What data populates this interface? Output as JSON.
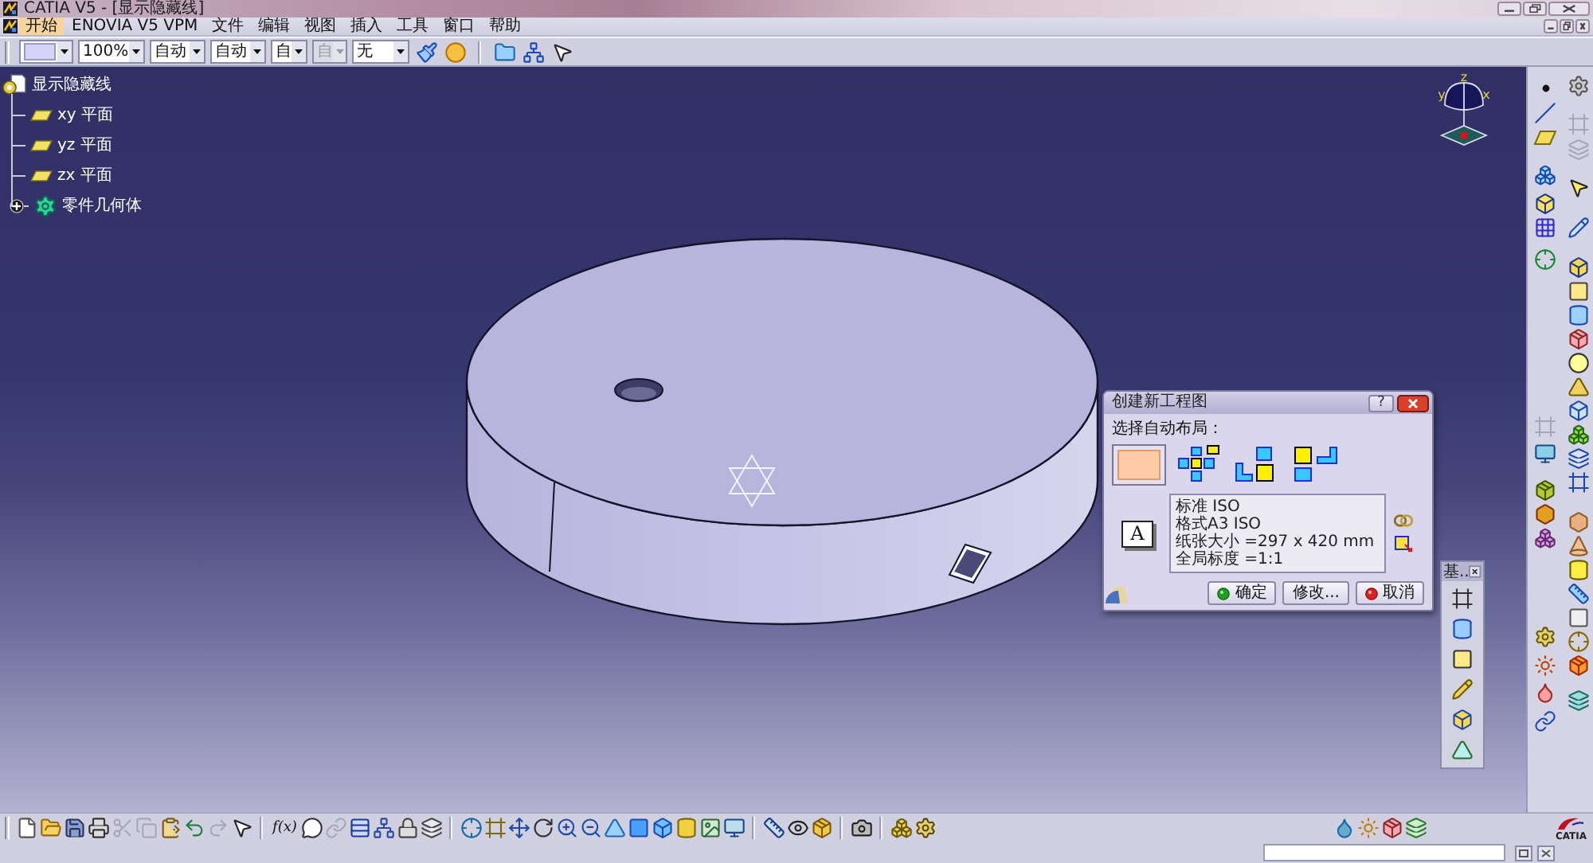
{
  "window": {
    "title": "CATIA V5 - [显示隐藏线]"
  },
  "menu_bar": {
    "items": [
      {
        "label": "开始",
        "selected": true
      },
      {
        "label": "ENOVIA V5 VPM",
        "selected": false
      },
      {
        "label": "文件",
        "selected": false
      },
      {
        "label": "编辑",
        "selected": false
      },
      {
        "label": "视图",
        "selected": false
      },
      {
        "label": "插入",
        "selected": false
      },
      {
        "label": "工具",
        "selected": false
      },
      {
        "label": "窗口",
        "selected": false
      },
      {
        "label": "帮助",
        "selected": false
      }
    ]
  },
  "format_toolbar": {
    "combos": [
      {
        "kind": "swatch",
        "disabled": false
      },
      {
        "kind": "text",
        "value": "100%",
        "disabled": false
      },
      {
        "kind": "text",
        "value": "自动",
        "disabled": false
      },
      {
        "kind": "text",
        "value": "自动",
        "disabled": false
      },
      {
        "kind": "text",
        "value": "自",
        "disabled": false
      },
      {
        "kind": "text",
        "value": "自",
        "disabled": true
      },
      {
        "kind": "text",
        "value": "无",
        "disabled": false
      }
    ]
  },
  "tree": {
    "label": "显示隐藏线",
    "children": [
      {
        "kind": "plane",
        "label": "xy 平面"
      },
      {
        "kind": "plane",
        "label": "yz 平面"
      },
      {
        "kind": "plane",
        "label": "zx 平面"
      },
      {
        "kind": "body",
        "label": "零件几何体",
        "expanded": false
      }
    ]
  },
  "compass": {
    "labels": [
      "z",
      "y",
      "x"
    ]
  },
  "dialog": {
    "title": "创建新工程图",
    "help_button": "?",
    "prompt": "选择自动布局：",
    "layouts": [
      {
        "selected": true
      },
      {
        "selected": false
      },
      {
        "selected": false
      },
      {
        "selected": false
      }
    ],
    "format_button": "A",
    "info_lines": [
      "标准 ISO",
      "格式A3 ISO",
      "纸张大小 =297 x 420 mm",
      "全局标度 =1:1"
    ],
    "buttons": [
      {
        "kind": "ok",
        "label": "确定"
      },
      {
        "kind": "plain",
        "label": "修改..."
      },
      {
        "kind": "cancel",
        "label": "取消"
      }
    ]
  },
  "floating_toolbar": {
    "title": "基.."
  },
  "right_toolbar": {
    "column_1": [
      {
        "disabled": false
      },
      {
        "disabled": false
      },
      {
        "disabled": false
      },
      {
        "disabled": false
      },
      {
        "disabled": false
      },
      {
        "disabled": false
      },
      {
        "disabled": false
      },
      {
        "disabled": true
      },
      {
        "disabled": false
      },
      {
        "disabled": false
      },
      {
        "disabled": false
      },
      {
        "disabled": false
      },
      {
        "disabled": false
      },
      {
        "disabled": false
      },
      {
        "disabled": false
      },
      {
        "disabled": false
      }
    ],
    "column_2": [
      {
        "disabled": false
      },
      {
        "disabled": true
      },
      {
        "disabled": true
      },
      {
        "disabled": false
      },
      {
        "disabled": false
      },
      {
        "disabled": false
      },
      {
        "disabled": false
      },
      {
        "disabled": false
      },
      {
        "disabled": false
      },
      {
        "disabled": false
      },
      {
        "disabled": false
      },
      {
        "disabled": false
      },
      {
        "disabled": false
      },
      {
        "disabled": false
      },
      {
        "disabled": false
      },
      {
        "disabled": false
      },
      {
        "disabled": false
      },
      {
        "disabled": false
      },
      {
        "disabled": false
      },
      {
        "disabled": false
      },
      {
        "disabled": false
      },
      {
        "disabled": false
      },
      {
        "disabled": false
      }
    ]
  },
  "bottom_toolbar": {
    "buttons": [
      {
        "disabled": false
      },
      {
        "disabled": false
      },
      {
        "disabled": false
      },
      {
        "disabled": false
      },
      {
        "disabled": true
      },
      {
        "disabled": true
      },
      {
        "disabled": false
      },
      {
        "disabled": false
      },
      {
        "disabled": true
      },
      {
        "disabled": false
      },
      {
        "label": "f(x)",
        "disabled": false
      },
      {
        "disabled": false
      },
      {
        "disabled": true
      },
      {
        "disabled": false
      },
      {
        "disabled": false
      },
      {
        "disabled": false
      },
      {
        "disabled": false
      },
      {
        "disabled": false
      },
      {
        "disabled": false
      },
      {
        "disabled": false
      },
      {
        "disabled": false
      },
      {
        "disabled": false
      },
      {
        "disabled": false
      },
      {
        "disabled": false
      },
      {
        "disabled": false
      },
      {
        "disabled": false
      },
      {
        "disabled": false
      },
      {
        "disabled": false
      },
      {
        "disabled": false
      },
      {
        "disabled": false
      },
      {
        "disabled": false
      },
      {
        "disabled": false
      },
      {
        "disabled": false
      },
      {
        "disabled": false
      },
      {
        "disabled": false
      }
    ]
  },
  "logo": {
    "text": "CATIA"
  }
}
